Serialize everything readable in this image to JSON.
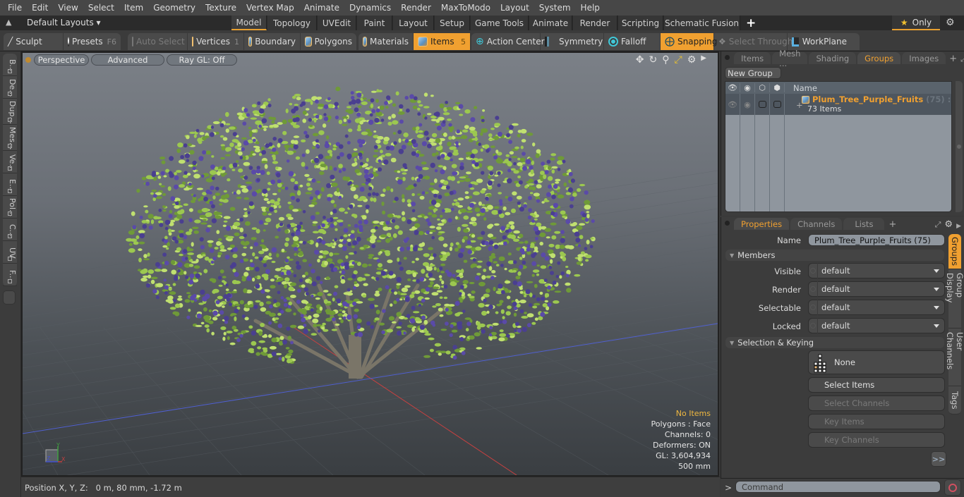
{
  "menubar": {
    "items": [
      "File",
      "Edit",
      "View",
      "Select",
      "Item",
      "Geometry",
      "Texture",
      "Vertex Map",
      "Animate",
      "Dynamics",
      "Render",
      "MaxToModo",
      "Layout",
      "System",
      "Help"
    ]
  },
  "layoutbar": {
    "layouts_label": "Default Layouts",
    "tabs": [
      "Model",
      "Topology",
      "UVEdit",
      "Paint",
      "Layout",
      "Setup",
      "Game Tools",
      "Animate",
      "Render",
      "Scripting",
      "Schematic Fusion"
    ],
    "active_tab": "Model",
    "add_tab": "+",
    "only_label": "Only"
  },
  "toolbar": {
    "sculpt": "Sculpt",
    "presets": "Presets",
    "presets_key": "F6",
    "auto_select": "Auto Select",
    "vertices": "Vertices",
    "vertices_count": "1",
    "boundary": "Boundary",
    "polygons": "Polygons",
    "materials": "Materials",
    "items": "Items",
    "items_count": "5",
    "action_center": "Action Center",
    "symmetry": "Symmetry",
    "falloff": "Falloff",
    "snapping": "Snapping",
    "select_through": "Select Through",
    "workplane": "WorkPlane"
  },
  "left_palette": {
    "tabs": [
      "B...",
      "De...",
      "Dup...",
      "Mes...",
      "Ve...",
      "E...",
      "Pol...",
      "C...",
      "UV",
      "F..."
    ]
  },
  "viewport": {
    "view_mode": "Perspective",
    "shading": "Advanced",
    "raygl": "Ray GL: Off",
    "hud": {
      "selection": "No Items",
      "polygons": "Polygons : Face",
      "channels": "Channels: 0",
      "deformers": "Deformers: ON",
      "gl": "GL: 3,604,934",
      "scale": "500 mm"
    },
    "axis_labels": {
      "x": "X",
      "y": "Y",
      "z": "Z"
    },
    "colors": {
      "leaf": "#9cc850",
      "fruit": "#4a3f90",
      "trunk": "#7a7568",
      "x_axis": "#c84040",
      "z_axis": "#5060d0"
    }
  },
  "statusbar": {
    "position": "Position X, Y, Z:   0 m, 80 mm, -1.72 m"
  },
  "groups_panel": {
    "tabs": [
      "Items",
      "Mesh ...",
      "Shading",
      "Groups",
      "Images"
    ],
    "active_tab": "Groups",
    "new_group": "New Group",
    "column_name": "Name",
    "groups": [
      {
        "name": "Plum_Tree_Purple_Fruits",
        "suffix": "(75) : ...",
        "sub": "73 Items"
      }
    ]
  },
  "properties_panel": {
    "tabs": [
      "Properties",
      "Channels",
      "Lists"
    ],
    "active_tab": "Properties",
    "name_label": "Name",
    "name_value": "Plum_Tree_Purple_Fruits (75)",
    "members_header": "Members",
    "fields": [
      {
        "label": "Visible",
        "value": "default"
      },
      {
        "label": "Render",
        "value": "default"
      },
      {
        "label": "Selectable",
        "value": "default"
      },
      {
        "label": "Locked",
        "value": "default"
      }
    ],
    "selection_header": "Selection & Keying",
    "none_label": "None",
    "buttons": [
      {
        "label": "Select Items",
        "enabled": true
      },
      {
        "label": "Select Channels",
        "enabled": false
      },
      {
        "label": "Key Items",
        "enabled": false
      },
      {
        "label": "Key Channels",
        "enabled": false
      }
    ],
    "more": ">>",
    "side_tabs": [
      "Groups",
      "Group Display",
      "User Channels",
      "Tags"
    ],
    "active_side_tab": "Groups"
  },
  "command": {
    "prompt": ">",
    "placeholder": "Command"
  },
  "accent": "#f0a030"
}
